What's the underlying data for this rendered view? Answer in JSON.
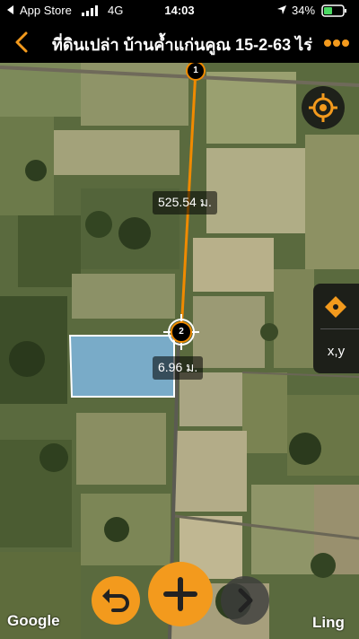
{
  "status_bar": {
    "back_app": "App Store",
    "network": "4G",
    "time": "14:03",
    "battery_pct": "34%"
  },
  "header": {
    "title": "ที่ดินเปล่า บ้านค้ำแก่นคูณ 15-2-63 ไร่"
  },
  "map": {
    "vertices": [
      {
        "label": "1"
      },
      {
        "label": "2"
      }
    ],
    "distance_labels": [
      "525.54 ม.",
      "6.96 ม."
    ],
    "side_panel": {
      "xy_label": "x,y"
    },
    "attribution": "Google",
    "footer_label": "Ling"
  },
  "colors": {
    "accent": "#f39a1d",
    "polygon_fill": "#7fb6e0",
    "measure_line": "#f08a00"
  },
  "icons": {
    "back": "chevron-left-icon",
    "more": "more-dots-icon",
    "locate": "crosshair-target-icon",
    "pin": "diamond-pin-icon",
    "undo": "undo-arrow-icon",
    "add": "plus-icon",
    "next": "chevron-right-icon"
  }
}
